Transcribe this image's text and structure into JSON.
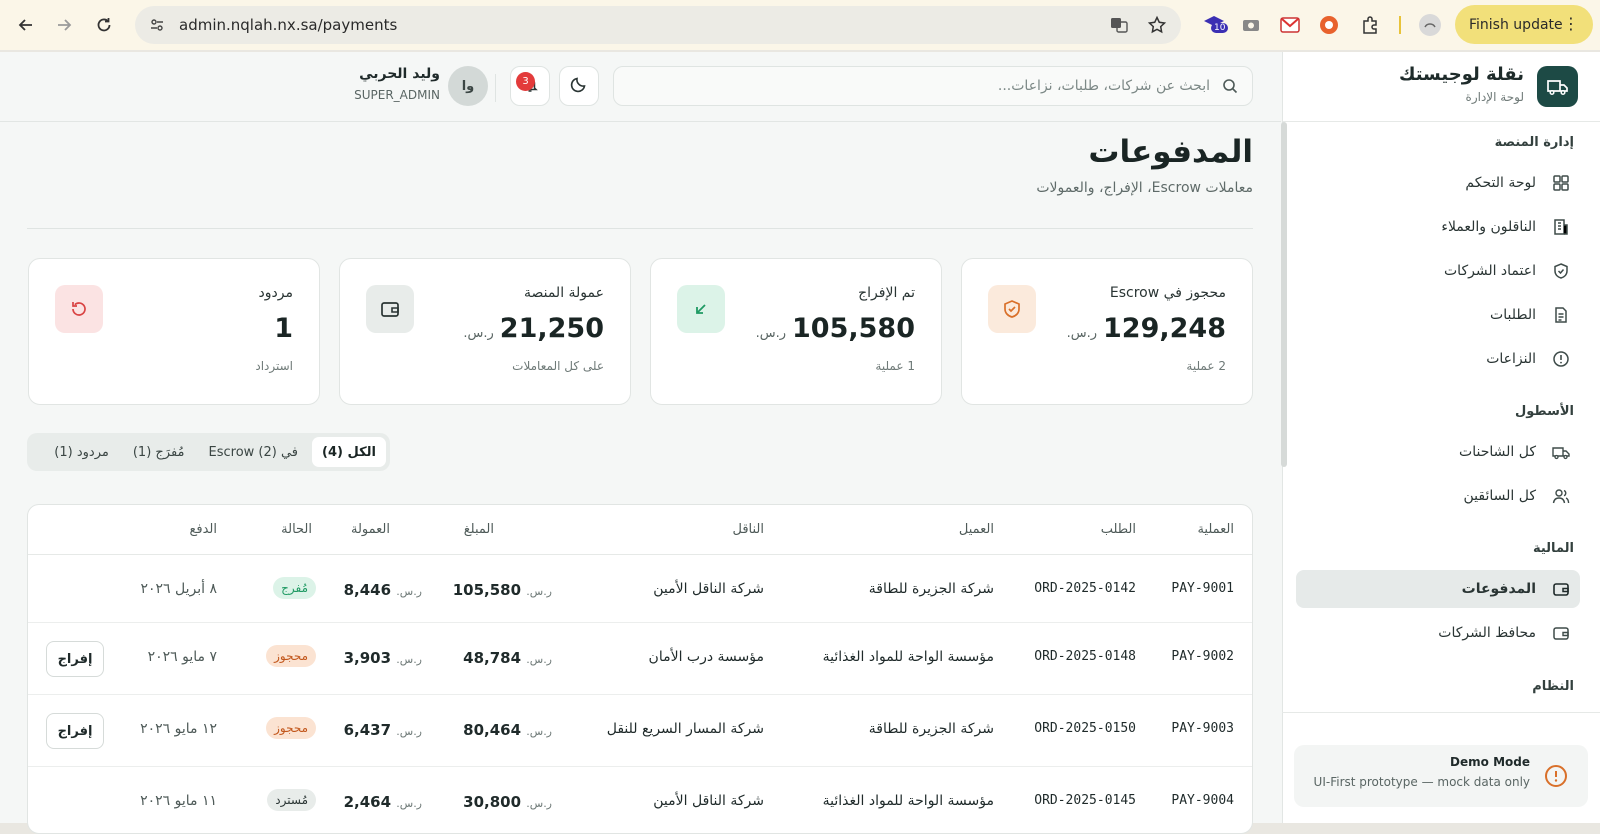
{
  "browser": {
    "url": "admin.nqlah.nx.sa/payments",
    "extension_badge": "10",
    "finish_update": "Finish update"
  },
  "brand": {
    "name": "نقلة لوجيستك",
    "sub": "لوحة الإدارة"
  },
  "sidebar": {
    "sections": [
      {
        "title": "إدارة المنصة"
      },
      {
        "title": "الأسطول"
      },
      {
        "title": "المالية"
      },
      {
        "title": "النظام"
      }
    ],
    "items": [
      {
        "label": "لوحة التحكم",
        "icon": "dashboard-icon"
      },
      {
        "label": "الناقلون والعملاء",
        "icon": "building-icon"
      },
      {
        "label": "اعتماد الشركات",
        "icon": "shield-check-icon"
      },
      {
        "label": "الطلبات",
        "icon": "document-icon"
      },
      {
        "label": "النزاعات",
        "icon": "alert-circle-icon"
      },
      {
        "label": "كل الشاحنات",
        "icon": "truck-icon"
      },
      {
        "label": "كل السائقين",
        "icon": "users-icon"
      },
      {
        "label": "المدفوعات",
        "icon": "wallet-icon",
        "active": true
      },
      {
        "label": "محافظ الشركات",
        "icon": "wallet-icon"
      }
    ],
    "demo": {
      "title": "Demo Mode",
      "text": "UI-First prototype — mock data only"
    }
  },
  "header": {
    "search_placeholder": "ابحث عن شركات، طلبات، نزاعات...",
    "notifications_count": "3",
    "user_initials": "وا",
    "user_name": "وليد الحربي",
    "user_role": "SUPER_ADMIN"
  },
  "page": {
    "title": "المدفوعات",
    "subtitle": "معاملات Escrow، الإفراج، والعمولات"
  },
  "cards": [
    {
      "label": "محجوز في Escrow",
      "value": "129,248",
      "currency": "ر.س.",
      "note": "2 عملية",
      "icon": "shield-icon",
      "bg": "#fbeadc",
      "fg": "#d9702a"
    },
    {
      "label": "تم الإفراج",
      "value": "105,580",
      "currency": "ر.س.",
      "note": "1 عملية",
      "icon": "arrow-down-left-icon",
      "bg": "#dcf3e8",
      "fg": "#1f9a63"
    },
    {
      "label": "عمولة المنصة",
      "value": "21,250",
      "currency": "ر.س.",
      "note": "على كل المعاملات",
      "icon": "wallet-icon",
      "bg": "#e8ecea",
      "fg": "#2a3534"
    },
    {
      "label": "مردود",
      "value": "1",
      "currency": "",
      "note": "استرداد",
      "icon": "refresh-icon",
      "bg": "#fbe3e3",
      "fg": "#d94343"
    }
  ],
  "tabs": [
    {
      "label": "الكل (4)",
      "active": true
    },
    {
      "label": "في Escrow (2)"
    },
    {
      "label": "مُفرَج (1)"
    },
    {
      "label": "مردود (1)"
    }
  ],
  "table": {
    "headers": [
      "العملية",
      "الطلب",
      "العميل",
      "الناقل",
      "المبلغ",
      "العمولة",
      "الحالة",
      "الدفع"
    ],
    "currency": "ر.س.",
    "rows": [
      {
        "op": "PAY-9001",
        "order": "ORD-2025-0142",
        "client": "شركة الجزيرة للطاقة",
        "carrier": "شركة الناقل الأمين",
        "amount": "105,580",
        "fee": "8,446",
        "status": "مُفرج",
        "status_bg": "#dcf3e8",
        "status_fg": "#1f9a63",
        "date": "٨ أبريل ٢٠٢٦",
        "action": ""
      },
      {
        "op": "PAY-9002",
        "order": "ORD-2025-0148",
        "client": "مؤسسة الواحة للمواد الغذائية",
        "carrier": "مؤسسة درب الأمان",
        "amount": "48,784",
        "fee": "3,903",
        "status": "محجوز",
        "status_bg": "#fbe3d2",
        "status_fg": "#c2571c",
        "date": "٧ مايو ٢٠٢٦",
        "action": "إفراج"
      },
      {
        "op": "PAY-9003",
        "order": "ORD-2025-0150",
        "client": "شركة الجزيرة للطاقة",
        "carrier": "شركة المسار السريع للنقل",
        "amount": "80,464",
        "fee": "6,437",
        "status": "محجوز",
        "status_bg": "#fbe3d2",
        "status_fg": "#c2571c",
        "date": "١٢ مايو ٢٠٢٦",
        "action": "إفراج"
      },
      {
        "op": "PAY-9004",
        "order": "ORD-2025-0145",
        "client": "مؤسسة الواحة للمواد الغذائية",
        "carrier": "شركة الناقل الأمين",
        "amount": "30,800",
        "fee": "2,464",
        "status": "مُسترد",
        "status_bg": "#e8ecea",
        "status_fg": "#2a3534",
        "date": "١١ مايو ٢٠٢٦",
        "action": ""
      }
    ]
  }
}
